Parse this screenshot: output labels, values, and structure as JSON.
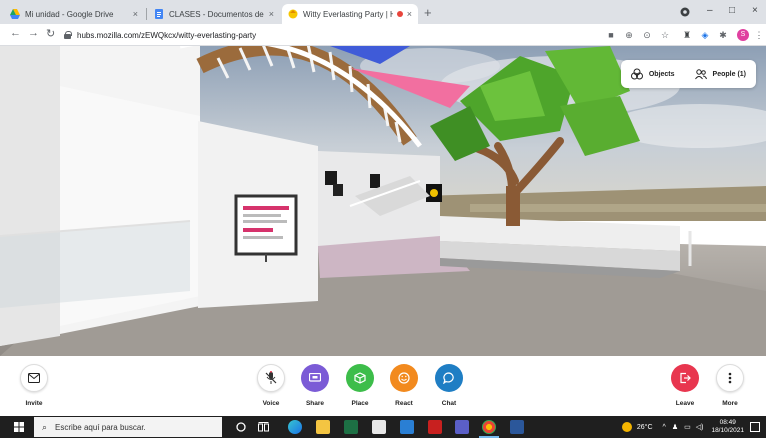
{
  "browser": {
    "tabs": [
      {
        "title": "Mi unidad - Google Drive",
        "close": "×",
        "active": false
      },
      {
        "title": "CLASES - Documentos de Google",
        "close": "×",
        "active": false
      },
      {
        "title": "Witty Everlasting Party | Hub",
        "close": "×",
        "active": true
      }
    ],
    "new_tab": "+",
    "window_controls": {
      "minimize": "–",
      "maximize": "□",
      "close": "×"
    },
    "url": "hubs.mozilla.com/zEWQkcx/witty-everlasting-party",
    "profile_initial": "S"
  },
  "room_panel": {
    "objects_label": "Objects",
    "people_label": "People (1)"
  },
  "hubs_toolbar": {
    "invite": "Invite",
    "voice": "Voice",
    "share": "Share",
    "place": "Place",
    "react": "React",
    "chat": "Chat",
    "leave": "Leave",
    "more": "More"
  },
  "colors": {
    "share": "#7b5bd6",
    "place": "#3dbd4a",
    "react": "#f28a1e",
    "chat": "#1f7ec4",
    "leave": "#e8364f"
  },
  "taskbar": {
    "search_placeholder": "Escribe aquí para buscar.",
    "temperature": "26°C",
    "time": "08:49",
    "date": "18/10/2021"
  }
}
